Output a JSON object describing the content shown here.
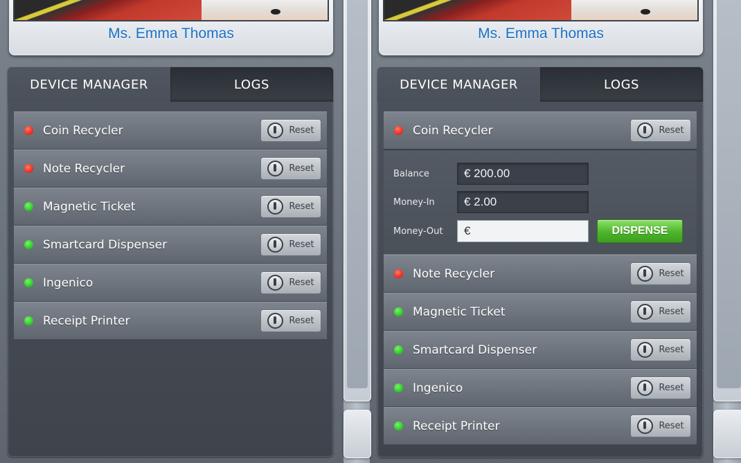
{
  "left_panel": {
    "profile_name": "Ms. Emma Thomas",
    "tabs": {
      "device_manager": "DEVICE MANAGER",
      "logs": "LOGS"
    },
    "devices": [
      {
        "label": "Coin Recycler",
        "status": "red",
        "reset": "Reset"
      },
      {
        "label": "Note Recycler",
        "status": "red",
        "reset": "Reset"
      },
      {
        "label": "Magnetic Ticket",
        "status": "green",
        "reset": "Reset"
      },
      {
        "label": "Smartcard Dispenser",
        "status": "green",
        "reset": "Reset"
      },
      {
        "label": "Ingenico",
        "status": "green",
        "reset": "Reset"
      },
      {
        "label": "Receipt Printer",
        "status": "green",
        "reset": "Reset"
      }
    ]
  },
  "right_panel": {
    "profile_name": "Ms. Emma Thomas",
    "tabs": {
      "device_manager": "DEVICE MANAGER",
      "logs": "LOGS"
    },
    "expanded_device": {
      "label": "Coin Recycler",
      "status": "red",
      "reset": "Reset"
    },
    "expanded_fields": {
      "balance_label": "Balance",
      "balance_value": "€ 200.00",
      "money_in_label": "Money-In",
      "money_in_value": "€ 2.00",
      "money_out_label": "Money-Out",
      "money_out_value": "€",
      "dispense_label": "DISPENSE"
    },
    "devices": [
      {
        "label": "Note Recycler",
        "status": "red",
        "reset": "Reset"
      },
      {
        "label": "Magnetic Ticket",
        "status": "green",
        "reset": "Reset"
      },
      {
        "label": "Smartcard Dispenser",
        "status": "green",
        "reset": "Reset"
      },
      {
        "label": "Ingenico",
        "status": "green",
        "reset": "Reset"
      },
      {
        "label": "Receipt Printer",
        "status": "green",
        "reset": "Reset"
      }
    ]
  },
  "colors": {
    "status_red": "#f22f1e",
    "status_green": "#2fcf2b",
    "name_blue": "#1b6fc4",
    "dispense_green": "#4cb52a"
  },
  "icons": [
    "power-icon",
    "status-dot-icon"
  ]
}
